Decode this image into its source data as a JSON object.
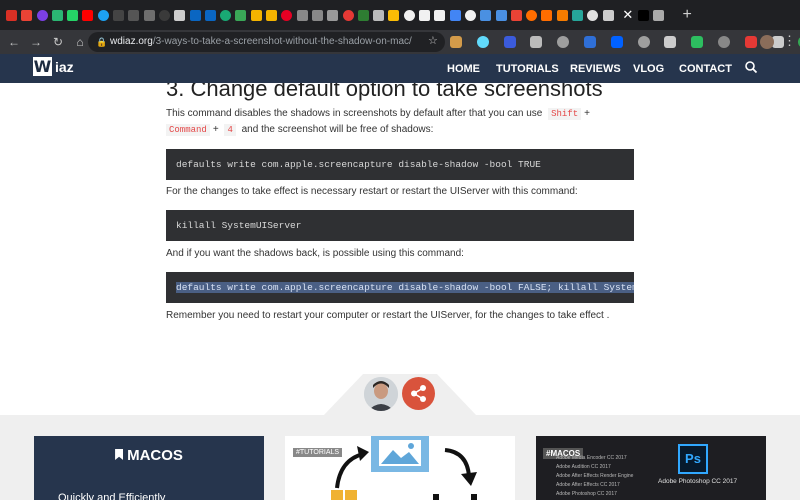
{
  "browser": {
    "url_host": "wdiaz.org",
    "url_path": "/3-ways-to-take-a-screenshot-without-the-shadow-on-mac/",
    "tab_favicons": [
      {
        "name": "gmail-icon",
        "color": "#d93025"
      },
      {
        "name": "gmail-icon",
        "color": "#ea4335"
      },
      {
        "name": "yahoo-mail-icon",
        "color": "#7b3fe4"
      },
      {
        "name": "green-app-icon",
        "color": "#2bb673"
      },
      {
        "name": "whatsapp-icon",
        "color": "#25d366"
      },
      {
        "name": "youtube-icon",
        "color": "#ff0000"
      },
      {
        "name": "twitter-icon",
        "color": "#1da1f2"
      },
      {
        "name": "dark-app-icon",
        "color": "#444444"
      },
      {
        "name": "dark-app-icon",
        "color": "#555555"
      },
      {
        "name": "github-icon",
        "color": "#6e6e6e"
      },
      {
        "name": "dark-app-icon",
        "color": "#3a3a3a"
      },
      {
        "name": "page-icon",
        "color": "#cccccc"
      },
      {
        "name": "linkedin-icon",
        "color": "#0a66c2"
      },
      {
        "name": "linkedin-icon",
        "color": "#0a66c2"
      },
      {
        "name": "k-icon",
        "color": "#19a974"
      },
      {
        "name": "green-app-icon",
        "color": "#3aa757"
      },
      {
        "name": "yellow-app-icon",
        "color": "#f4b400"
      },
      {
        "name": "yellow-app-icon",
        "color": "#f4b400"
      },
      {
        "name": "pinterest-icon",
        "color": "#e60023"
      },
      {
        "name": "gray-app-icon",
        "color": "#888888"
      },
      {
        "name": "gray-app-icon",
        "color": "#888888"
      },
      {
        "name": "page-icon",
        "color": "#999999"
      },
      {
        "name": "red-app-icon",
        "color": "#e53935"
      },
      {
        "name": "leaf-icon",
        "color": "#2e7d32"
      },
      {
        "name": "page-icon",
        "color": "#bbbbbb"
      },
      {
        "name": "chart-icon",
        "color": "#fbbc05"
      },
      {
        "name": "chrome-icon",
        "color": "#f1f1f1"
      },
      {
        "name": "chrome-icon",
        "color": "#f1f1f1"
      },
      {
        "name": "chrome-icon",
        "color": "#f1f1f1"
      },
      {
        "name": "google-icon",
        "color": "#4285f4"
      },
      {
        "name": "chrome-icon",
        "color": "#f1f1f1"
      },
      {
        "name": "blue-app-icon",
        "color": "#4a90e2"
      },
      {
        "name": "blue-app-icon",
        "color": "#4a90e2"
      },
      {
        "name": "red-app-icon",
        "color": "#ea4335"
      },
      {
        "name": "orange-app-icon",
        "color": "#ff6d00"
      },
      {
        "name": "orange-app-icon",
        "color": "#ff6d00"
      },
      {
        "name": "box-icon",
        "color": "#f57c00"
      },
      {
        "name": "box-icon",
        "color": "#26a69a"
      },
      {
        "name": "cloud-icon",
        "color": "#e0e0e0"
      },
      {
        "name": "page-icon",
        "color": "#cccccc"
      },
      {
        "name": "medium-icon",
        "color": "#000000"
      },
      {
        "name": "apple-icon",
        "color": "#aaaaaa"
      }
    ],
    "ext_icons": [
      {
        "name": "cookie-extension-icon",
        "color": "#d39b4a"
      },
      {
        "name": "react-extension-icon",
        "color": "#61dafb"
      },
      {
        "name": "red-extension-icon",
        "color": "#3b5bdb"
      },
      {
        "name": "grid-extension-icon",
        "color": "#bbbbbb"
      },
      {
        "name": "globe-extension-icon",
        "color": "#9e9e9e"
      },
      {
        "name": "d-extension-icon",
        "color": "#2f6fd6"
      },
      {
        "name": "dropbox-extension-icon",
        "color": "#0061ff"
      },
      {
        "name": "grid-extension-icon",
        "color": "#9e9e9e"
      },
      {
        "name": "camera-extension-icon",
        "color": "#cccccc"
      },
      {
        "name": "evernote-extension-icon",
        "color": "#2dbe60"
      },
      {
        "name": "gray-extension-icon",
        "color": "#888888"
      },
      {
        "name": "red-extension-icon",
        "color": "#e53935"
      },
      {
        "name": "outline-extension-icon",
        "color": "#cccccc"
      },
      {
        "name": "green-extension-icon",
        "color": "#34a853"
      },
      {
        "name": "grammarly-extension-icon",
        "color": "#15c39a"
      }
    ]
  },
  "site": {
    "logo_letter": "W",
    "logo_text": "iaz",
    "nav": [
      "HOME",
      "TUTORIALS",
      "REVIEWS",
      "VLOG",
      "CONTACT"
    ]
  },
  "article": {
    "heading": "3. Change default option to take screenshots",
    "para1_before": "This command disables the shadows in screenshots by default after that you can use",
    "key_shift": "Shift",
    "plus1": "+",
    "key_command": "Command",
    "plus2": "+",
    "key_4": "4",
    "para1_after": "and the screenshot will be free of shadows:",
    "code1": "defaults write com.apple.screencapture disable-shadow -bool TRUE",
    "para2": "For the changes to take effect is necessary restart or restart the UIServer with this command:",
    "code2": "killall SystemUIServer",
    "para3": "And if you want the shadows back, is possible using this command:",
    "code3": "defaults write com.apple.screencapture disable-shadow -bool FALSE; killall SystemUIServer",
    "para4": "Remember you need to restart your computer or restart the UIServer, for the changes to take effect ."
  },
  "cards": {
    "card1_title": "MACOS",
    "card1_teaser": "Quickly and Efficiently",
    "card2_tag": "#TUTORIALS",
    "card3_tag": "#MACOS",
    "card3_menu": [
      "Adobe Media Encoder CC 2017",
      "Adobe Audition CC 2017",
      "Adobe After Effects Render Engine",
      "Adobe After Effects CC 2017",
      "Adobe Photoshop CC 2017"
    ],
    "ps_icon": "Ps",
    "ps_label": "Adobe Photoshop CC 2017"
  }
}
